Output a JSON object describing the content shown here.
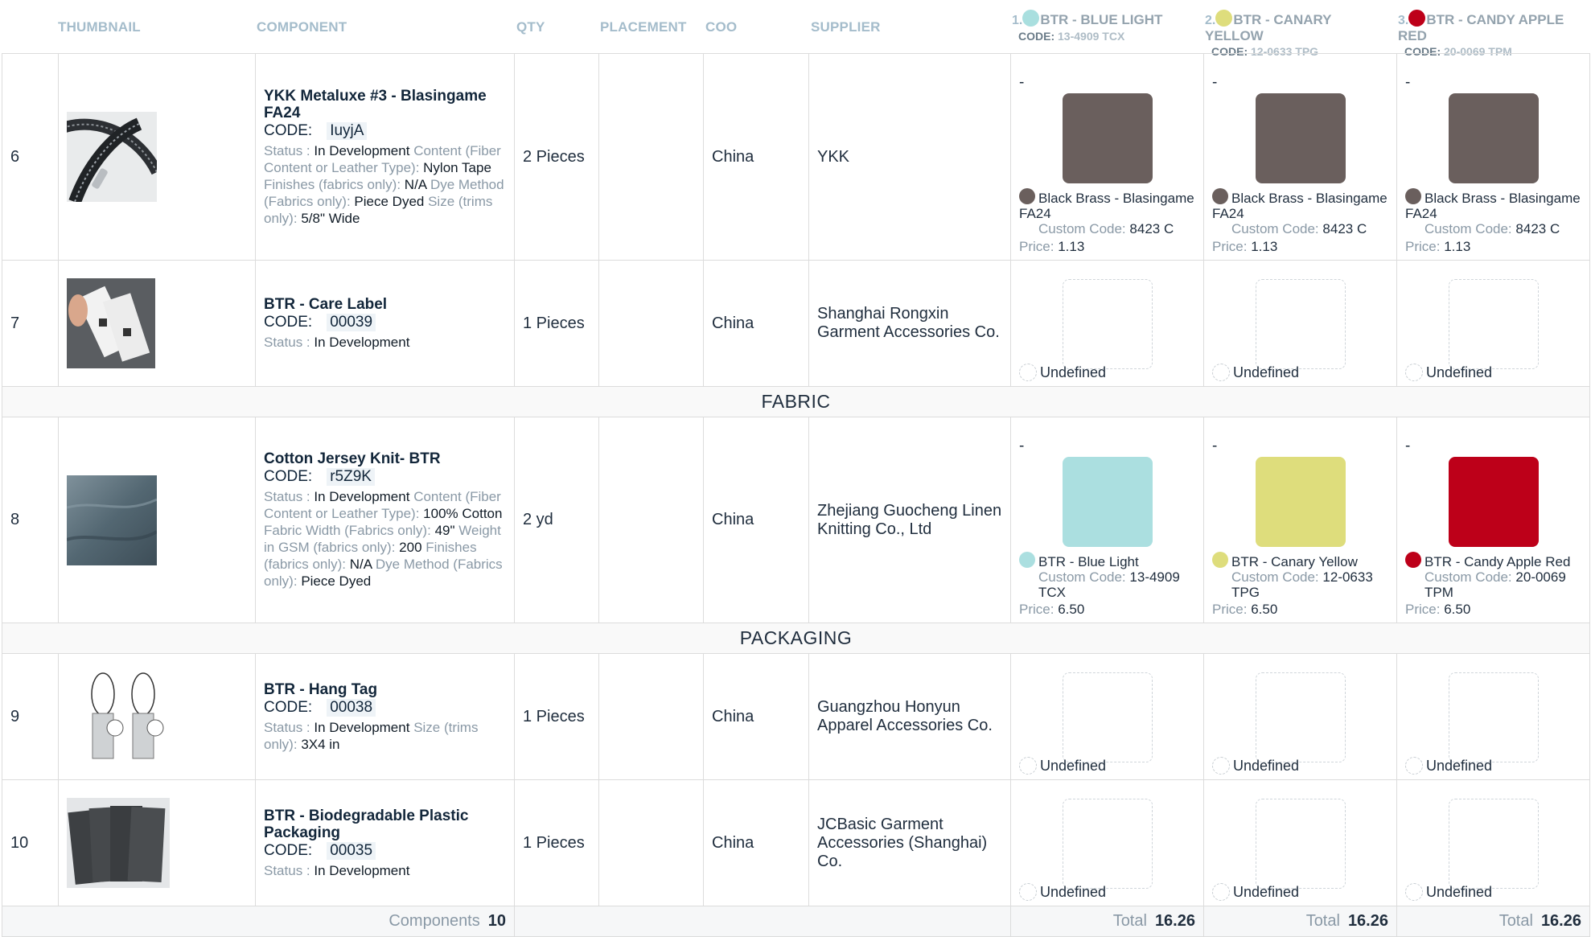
{
  "header": {
    "col_thumbnail": "THUMBNAIL",
    "col_component": "COMPONENT",
    "col_qty": "QTY",
    "col_placement": "PLACEMENT",
    "col_coo": "COO",
    "col_supplier": "SUPPLIER",
    "colors": [
      {
        "num": "1.",
        "name": "BTR - BLUE LIGHT",
        "code_label": "CODE:",
        "code": "13-4909 TCX",
        "dot": "#a9dfdf"
      },
      {
        "num": "2.",
        "name": "BTR - CANARY YELLOW",
        "code_label": "CODE:",
        "code": "12-0633 TPG",
        "dot": "#dedd7c"
      },
      {
        "num": "3.",
        "name": "BTR - CANDY APPLE RED",
        "code_label": "CODE:",
        "code": "20-0069 TPM",
        "dot": "#bd0019"
      }
    ]
  },
  "labels": {
    "code": "CODE:",
    "status": "Status :",
    "custom_code": "Custom Code:",
    "price": "Price:",
    "undefined": "Undefined",
    "dash": "-"
  },
  "rows": [
    {
      "index": "6",
      "name": "YKK Metaluxe #3 - Blasingame FA24",
      "code": "IuyjA",
      "status": "In Development",
      "attrs": [
        {
          "k": "Content (Fiber Content or Leather Type):",
          "v": "Nylon Tape"
        },
        {
          "k": "Finishes (fabrics only):",
          "v": "N/A"
        },
        {
          "k": "Dye Method (Fabrics only):",
          "v": "Piece Dyed"
        },
        {
          "k": "Size (trims only):",
          "v": "5/8\" Wide"
        }
      ],
      "qty": "2 Pieces",
      "placement": "",
      "coo": "China",
      "supplier": "YKK",
      "colors": [
        {
          "material": "Black Brass - Blasingame FA24",
          "custom_code": "8423 C",
          "price": "1.13"
        },
        {
          "material": "Black Brass - Blasingame FA24",
          "custom_code": "8423 C",
          "price": "1.13"
        },
        {
          "material": "Black Brass - Blasingame FA24",
          "custom_code": "8423 C",
          "price": "1.13"
        }
      ]
    },
    {
      "index": "7",
      "name": "BTR - Care Label",
      "code": "00039",
      "status": "In Development",
      "qty": "1 Pieces",
      "placement": "",
      "coo": "China",
      "supplier": "Shanghai Rongxin Garment Accessories Co."
    },
    {
      "index": "8",
      "name": "Cotton Jersey Knit- BTR",
      "code": "r5Z9K",
      "status": "In Development",
      "attrs": [
        {
          "k": "Content (Fiber Content or Leather Type):",
          "v": "100% Cotton"
        },
        {
          "k": "Fabric Width (Fabrics only):",
          "v": "49\""
        },
        {
          "k": "Weight in GSM (fabrics only):",
          "v": "200"
        },
        {
          "k": "Finishes (fabrics only):",
          "v": "N/A"
        },
        {
          "k": "Dye Method (Fabrics only):",
          "v": "Piece Dyed"
        }
      ],
      "qty": "2 yd",
      "placement": "",
      "coo": "China",
      "supplier": "Zhejiang Guocheng Linen Knitting Co., Ltd",
      "colors": [
        {
          "material": "BTR - Blue Light",
          "custom_code": "13-4909 TCX",
          "price": "6.50"
        },
        {
          "material": "BTR - Canary Yellow",
          "custom_code": "12-0633 TPG",
          "price": "6.50"
        },
        {
          "material": "BTR - Candy Apple Red",
          "custom_code": "20-0069 TPM",
          "price": "6.50"
        }
      ]
    },
    {
      "index": "9",
      "name": "BTR - Hang Tag",
      "code": "00038",
      "status": "In Development",
      "attrs": [
        {
          "k": "Size (trims only):",
          "v": "3X4 in"
        }
      ],
      "qty": "1 Pieces",
      "placement": "",
      "coo": "China",
      "supplier": "Guangzhou Honyun Apparel Accessories Co."
    },
    {
      "index": "10",
      "name": "BTR - Biodegradable Plastic Packaging",
      "code": "00035",
      "status": "In Development",
      "qty": "1 Pieces",
      "placement": "",
      "coo": "China",
      "supplier": "JCBasic Garment Accessories (Shanghai) Co."
    }
  ],
  "sections": {
    "fabric": "FABRIC",
    "packaging": "PACKAGING"
  },
  "footer": {
    "components_label": "Components",
    "components_count": "10",
    "total_label": "Total",
    "totals": [
      "16.26",
      "16.26",
      "16.26"
    ]
  },
  "swatch_colors": {
    "black_brass": "#6a5f5d",
    "blue_light": "#abdfe0",
    "canary_yellow": "#dedd7c",
    "candy_apple_red": "#bd0019"
  }
}
